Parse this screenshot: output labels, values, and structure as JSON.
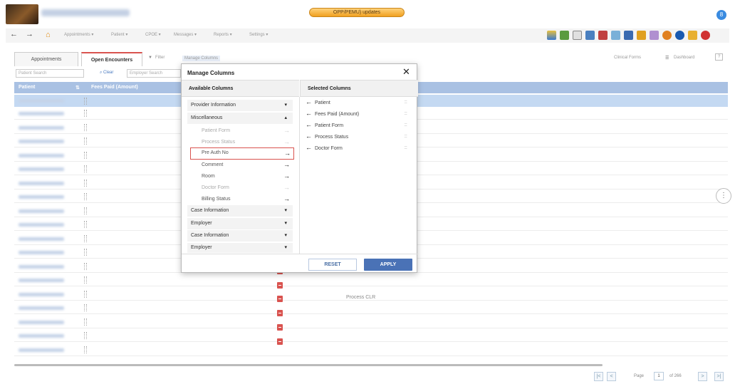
{
  "header": {
    "updates_badge": "OPP/PEMU) updates",
    "user_initial": "8"
  },
  "nav": {
    "back": "←",
    "forward": "→",
    "home": "⌂",
    "menus": [
      "Appointments ▾",
      "Patient ▾",
      "CPOE ▾",
      "Messages ▾",
      "Reports ▾",
      "Settings ▾"
    ]
  },
  "tabs": {
    "appointments": "Appointments",
    "open_encounters": "Open Encounters",
    "filter": "Filter",
    "manage_columns": "Manage Columns",
    "clinical_forms": "Clinical Forms",
    "dashboard": "Dashboard"
  },
  "search": {
    "patient_placeholder": "Patient Search",
    "clear": "Clear",
    "employer_placeholder": "Employer Search"
  },
  "grid": {
    "col_patient": "Patient",
    "col_fees": "Fees Paid (Amount)",
    "process_clr": "Process CLR"
  },
  "pager": {
    "first": "|<",
    "prev": "<",
    "page_label": "Page",
    "page_value": "1",
    "of_label": "of 266",
    "next": ">",
    "last": ">|"
  },
  "modal": {
    "title": "Manage Columns",
    "close": "✕",
    "available_header": "Available Columns",
    "selected_header": "Selected Columns",
    "groups": [
      {
        "label": "Provider Information",
        "chevron": "▾"
      },
      {
        "label": "Miscellaneous",
        "chevron": "▴"
      },
      {
        "label": "Case Information",
        "chevron": "▾"
      },
      {
        "label": "Employer",
        "chevron": "▾"
      },
      {
        "label": "Case Information",
        "chevron": "▾"
      },
      {
        "label": "Employer",
        "chevron": "▾"
      }
    ],
    "misc_items": [
      {
        "label": "Patient Form",
        "arrow": "→"
      },
      {
        "label": "Process Status",
        "arrow": "→"
      },
      {
        "label": "Pre Auth No",
        "arrow": "→"
      },
      {
        "label": "Comment",
        "arrow": "→"
      },
      {
        "label": "Room",
        "arrow": "→"
      },
      {
        "label": "Doctor Form",
        "arrow": "→"
      },
      {
        "label": "Billing Status",
        "arrow": "→"
      }
    ],
    "selected": [
      {
        "label": "Patient",
        "arrow": "←",
        "drag": "::::"
      },
      {
        "label": "Fees Paid (Amount)",
        "arrow": "←",
        "drag": "::::"
      },
      {
        "label": "Patient Form",
        "arrow": "←",
        "drag": "::::"
      },
      {
        "label": "Process Status",
        "arrow": "←",
        "drag": "::::"
      },
      {
        "label": "Doctor Form",
        "arrow": "←",
        "drag": "::::"
      }
    ],
    "reset": "RESET",
    "apply": "APPLY"
  },
  "colors": {
    "grid_header": "#a9c1e3",
    "selected_row": "#c4d9f2",
    "accent_red": "#d9534f",
    "apply_blue": "#4a72b6"
  }
}
